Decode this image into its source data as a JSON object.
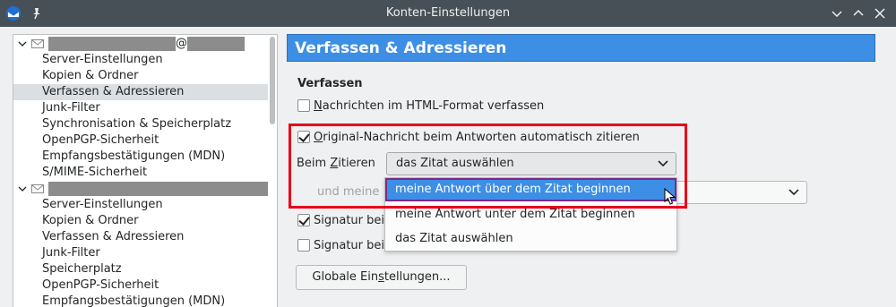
{
  "window": {
    "title": "Konten-Einstellungen"
  },
  "tree": {
    "accounts": [
      {
        "label_suffix": "@",
        "items": [
          "Server-Einstellungen",
          "Kopien & Ordner",
          "Verfassen & Adressieren",
          "Junk-Filter",
          "Synchronisation & Speicherplatz",
          "OpenPGP-Sicherheit",
          "Empfangsbestätigungen (MDN)",
          "S/MIME-Sicherheit"
        ],
        "selected_index": 2
      },
      {
        "label_suffix": "",
        "items": [
          "Server-Einstellungen",
          "Kopien & Ordner",
          "Verfassen & Adressieren",
          "Junk-Filter",
          "Speicherplatz",
          "OpenPGP-Sicherheit",
          "Empfangsbestätigungen (MDN)"
        ]
      }
    ]
  },
  "pane": {
    "header": "Verfassen & Adressieren",
    "section_title": "Verfassen",
    "html_compose": {
      "u": "N",
      "rest": "achrichten im HTML-Format verfassen",
      "checked": false
    },
    "auto_quote": {
      "u": "O",
      "rest": "riginal-Nachricht beim Antworten automatisch zitieren",
      "checked": true
    },
    "quote_label": {
      "pre": "Beim ",
      "u": "Z",
      "post": "itieren"
    },
    "quote_select": {
      "value": "das Zitat auswählen"
    },
    "reply_label": "und meine",
    "signature_1": {
      "text": "Signatur bei",
      "checked": true
    },
    "signature_2": {
      "text": "Signatur bei",
      "checked": false
    },
    "global_settings": {
      "pre": "Globale Ein",
      "u": "s",
      "post": "tellungen..."
    }
  },
  "dropdown": {
    "options": [
      "meine Antwort über dem Zitat beginnen",
      "meine Antwort unter dem Zitat beginnen",
      "das Zitat auswählen"
    ],
    "active_index": 0
  },
  "colors": {
    "titlebar": "#475057",
    "accent": "#3d8ee5",
    "annotation_red": "#e8001c"
  }
}
